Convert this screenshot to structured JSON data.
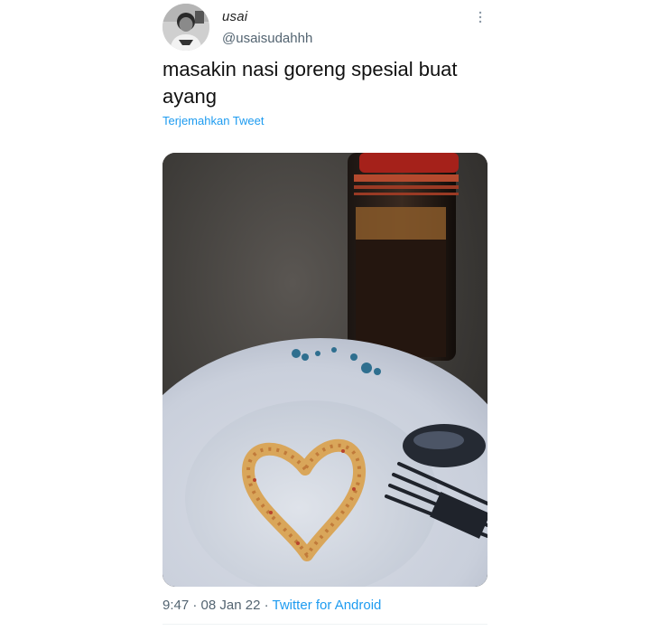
{
  "user": {
    "display_name": "usai",
    "handle": "@usaisudahhh",
    "avatar_icon": "user-avatar"
  },
  "tweet": {
    "text": "masakin nasi goreng spesial buat ayang",
    "translate_label": "Terjemahkan Tweet",
    "media_icon": "photo-plate-heart-rice"
  },
  "meta": {
    "time": "9:47",
    "separator": "·",
    "date": "08 Jan 22",
    "source": "Twitter for Android"
  },
  "colors": {
    "link": "#1d9bf0",
    "secondary_text": "#536471",
    "primary_text": "#0f1419"
  }
}
